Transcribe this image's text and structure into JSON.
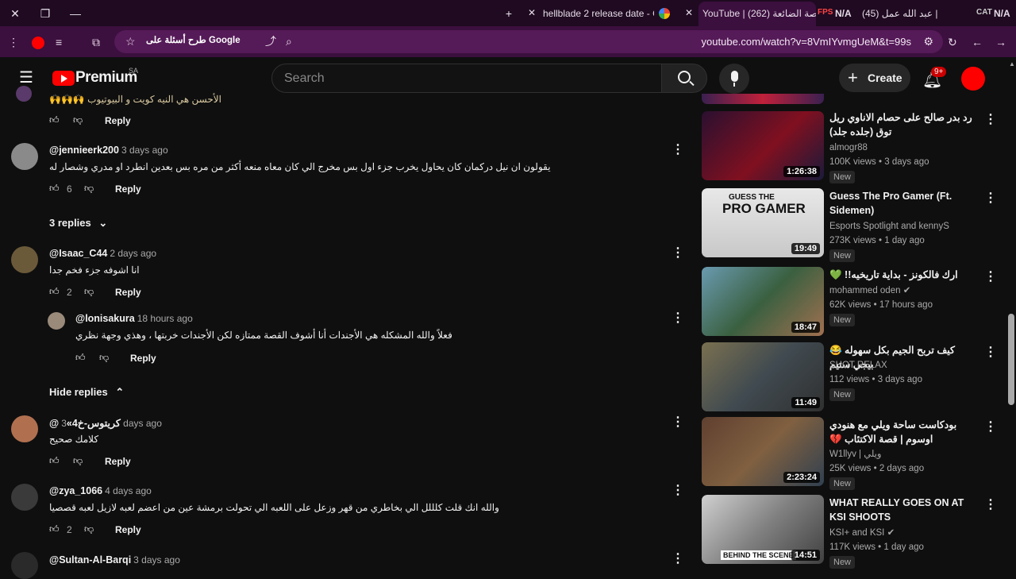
{
  "browser": {
    "tabs": [
      {
        "title": "hellblade 2 release date - Goo"
      },
      {
        "title": "YouTube | الفرصة الضائعة (262)"
      },
      {
        "title": "N/A"
      },
      {
        "title": "عبد الله عمل (45) | "
      },
      {
        "title": "N/A"
      }
    ],
    "url": "youtube.com/watch?v=8VmIYvmgUeM&t=99s",
    "google_chip": "طرح أسئلة على Google"
  },
  "youtube": {
    "logo": "Premium",
    "region": "SA",
    "search_placeholder": "Search",
    "create_label": "Create",
    "notif_count": "9+"
  },
  "comments": [
    {
      "user": "@jennieerk200",
      "date": "3 days ago",
      "text": "يقولون ان نيل دركمان كان يحاول يخرب جزء اول بس مخرج الي كان معاه منعه أكثر من مره بس بعدين انطرد او مدري وشصار له",
      "likes": "6",
      "reply": "Reply",
      "replies_label": "3 replies"
    },
    {
      "user": "@Isaac_C44",
      "date": "2 days ago",
      "text": "انا اشوفه جزء فخم جدا",
      "likes": "2",
      "reply": "Reply"
    },
    {
      "user": "@lonisakura",
      "date": "18 hours ago",
      "text": "فعلاً والله المشكله هي الأجندات أنا أشوف القصة ممتازه لكن الأجندات خربتها ، وهذي وجهة نظري",
      "likes": "",
      "reply": "Reply",
      "hide_label": "Hide replies"
    },
    {
      "user": "@كريتوس-خ4»",
      "date": "3 days ago",
      "text": "كلامك صحيح",
      "likes": "",
      "reply": "Reply"
    },
    {
      "user": "@zya_1066",
      "date": "4 days ago",
      "text": "والله انك قلت كلللل الي بخاطري من قهر وزعل على اللعبه الي تحولت برمشة عين من اعضم لعبه لازيل لعبه قصصيا",
      "likes": "2",
      "reply": "Reply"
    },
    {
      "user": "@Sultan-Al-Barqi",
      "date": "3 days ago",
      "text": "",
      "likes": "",
      "reply": ""
    }
  ],
  "top_reply_label": "Reply",
  "sidebar": [
    {
      "title": "رد بدر صالح على حصام الاناوي ريل توق (جلده جلد)",
      "channel": "almogr88",
      "meta": "100K views • 3 days ago",
      "badge": "New",
      "duration": "1:26:38"
    },
    {
      "title": "Guess The Pro Gamer (Ft. Sidemen)",
      "channel": "Esports Spotlight and kennyS",
      "meta": "273K views • 1 day ago",
      "badge": "New",
      "duration": "19:49"
    },
    {
      "title": "ارك فالكونز - بداية تاريخيه!! 💚",
      "channel": "mohammed oden",
      "meta": "62K views • 17 hours ago",
      "badge": "New",
      "duration": "18:47"
    },
    {
      "title": "كيف تربح الجيم بكل سهوله 😂 بيجي ستيم",
      "channel": "SHOT RELAX",
      "meta": "112 views • 3 days ago",
      "badge": "New",
      "duration": "11:49"
    },
    {
      "title": "بودكاست ساحة ويلي مع هنودي اوسوم | قصة الاكتئاب 💔",
      "channel": "W1llyv | ويلي",
      "meta": "25K views • 2 days ago",
      "badge": "New",
      "duration": "2:23:24"
    },
    {
      "title": "WHAT REALLY GOES ON AT KSI SHOOTS",
      "channel": "KSI+ and KSI",
      "meta": "117K views • 1 day ago",
      "badge": "New",
      "duration": "14:51"
    }
  ]
}
